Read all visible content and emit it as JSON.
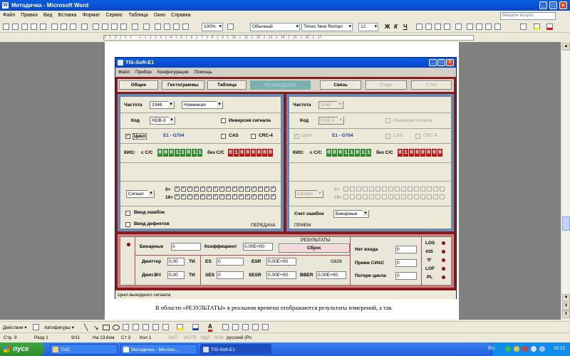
{
  "word": {
    "title": "Методичка - Microsoft Word",
    "menu": [
      "Файл",
      "Правка",
      "Вид",
      "Вставка",
      "Формат",
      "Сервис",
      "Таблица",
      "Окно",
      "Справка"
    ],
    "ask_placeholder": "Введите вопрос",
    "zoom": "100%",
    "style": "Обычный",
    "font": "Times New Roman",
    "font_size": "12",
    "bold": "Ж",
    "italic": "К",
    "underline": "Ч",
    "ruler_text": "3 · 1 · 2 · 1 · 1 · 1 · · · 1 · 1 · 2 · 1 · 3 · 1 · 4 · 1 · 5 · 1 · 6 · 1 · 7 · 1 · 8 · 1 · 9 · 1 · 10 · 1 · 11 · 1 · 12 · 1 · 13 · 1 · 14 · 1 · 15 · 1 · 16 · 1 · 17 ·",
    "doc_text": "В области «РЕЗУЛЬТАТЫ» в реальном времени отображаются результаты измерений, а так",
    "draw_toolbar": {
      "actions": "Действия ▾",
      "autoshapes": "Автофигуры ▾"
    },
    "status": {
      "page": "Стр.  9",
      "section": "Разд  1",
      "pages": "9/11",
      "at": "На 13,6см",
      "line": "Ст  3",
      "col": "Кол  1",
      "rec": "ЗАП",
      "trk": "ИСПР",
      "ext": "ВДЛ",
      "ovr": "ЗАМ",
      "lang": "русский (Ро"
    }
  },
  "app": {
    "title": "TIS-Soft-E1",
    "menu": [
      "Файл",
      "Прибор",
      "Конфигурация",
      "Помощь"
    ],
    "tabs": {
      "general": "Общее",
      "histograms": "Гистограммы",
      "table": "Таблица",
      "brand": "ТЕХНОДАТА",
      "connection": "Связь",
      "start": "Старт",
      "stop": "Стоп"
    },
    "left": {
      "freq_label": "Частота",
      "freq_value": "2048",
      "freq_mode": "Номинная",
      "code_label": "Код",
      "code_value": "HDB-3",
      "inv_label": "Инверсия сигнала",
      "cycle_label": "Цикл",
      "cycle_checked": "✓",
      "e1_label": "Е1 - G704",
      "cas_label": "CAS",
      "crc_label": "CRC-4",
      "kio_label": "КИО:",
      "with_label": "с С/С",
      "with_bits": [
        "0",
        "0",
        "0",
        "1",
        "1",
        "0",
        "1",
        "1"
      ],
      "without_label": "без С/С",
      "without_bits": [
        "0",
        "1",
        "0",
        "0",
        "0",
        "0",
        "0",
        "0"
      ],
      "signal_value": "Сигнал",
      "row0_label": "0>",
      "row16_label": "16>",
      "check_mark": "✓",
      "err_label": "Ввод ошибок",
      "def_label": "Ввод дефектов",
      "footer": "ПЕРЕДАЧА"
    },
    "right": {
      "freq_label": "Частота",
      "freq_value": "2048",
      "code_label": "Код",
      "code_value": "HDB-3",
      "inv_label": "Инверсия сигнала",
      "cycle_label": "Цикл",
      "cycle_checked": "✓",
      "e1_label": "Е1 - G704",
      "cas_label": "CAS",
      "crc_label": "CRC-4",
      "kio_label": "КИО:",
      "with_label": "с С/С",
      "with_bits": [
        "0",
        "0",
        "0",
        "1",
        "1",
        "0",
        "1",
        "1"
      ],
      "without_label": "без С/С",
      "without_bits": [
        "0",
        "1",
        "0",
        "0",
        "0",
        "0",
        "0",
        "0"
      ],
      "signal_value": "Сигнал",
      "row0_label": "0>",
      "row16_label": "16>",
      "err_count_label": "Счет ошибок",
      "err_count_value": "Бинарные",
      "footer": "ПРИЕМ"
    },
    "results": {
      "header": "РЕЗУЛЬТАТЫ",
      "reset": "Сброс",
      "binary_label": "Бинарные",
      "binary_value": "0",
      "coef_label": "Коэффициент",
      "coef_value": "0,00E+00",
      "jitter_label": "Джиттер",
      "jitter_value": "0,00",
      "jitter_unit": "TИ",
      "jit_hf_label": "Джит.ВЧ",
      "jit_hf_value": "0,00",
      "jit_hf_unit": "TИ",
      "es_label": "ES",
      "es_value": "0",
      "esr_label": "ESR",
      "esr_value": "0,00E+00",
      "g826": "G826",
      "ses_label": "SES",
      "ses_value": "0",
      "sesr_label": "SESR",
      "sesr_value": "0,00E+00",
      "bber_label": "BBER",
      "bber_value": "0,00E+00",
      "noinput_label": "Нет входа",
      "noinput_value": "0",
      "ais_label": "Прием СИАС",
      "ais_value": "0",
      "losscycle_label": "Потеря цикла",
      "losscycle_value": "0",
      "alarms": [
        "LOS",
        "AIS",
        "'0'",
        "LOF",
        "PL"
      ]
    },
    "statusbar": "Цикл выходного сигнала"
  },
  "taskbar": {
    "start": "пуск",
    "tasks": [
      "ТИС",
      "Методичка - Microso...",
      "TIS-Soft-E1"
    ],
    "lang": "RU",
    "clock": "20:22"
  }
}
